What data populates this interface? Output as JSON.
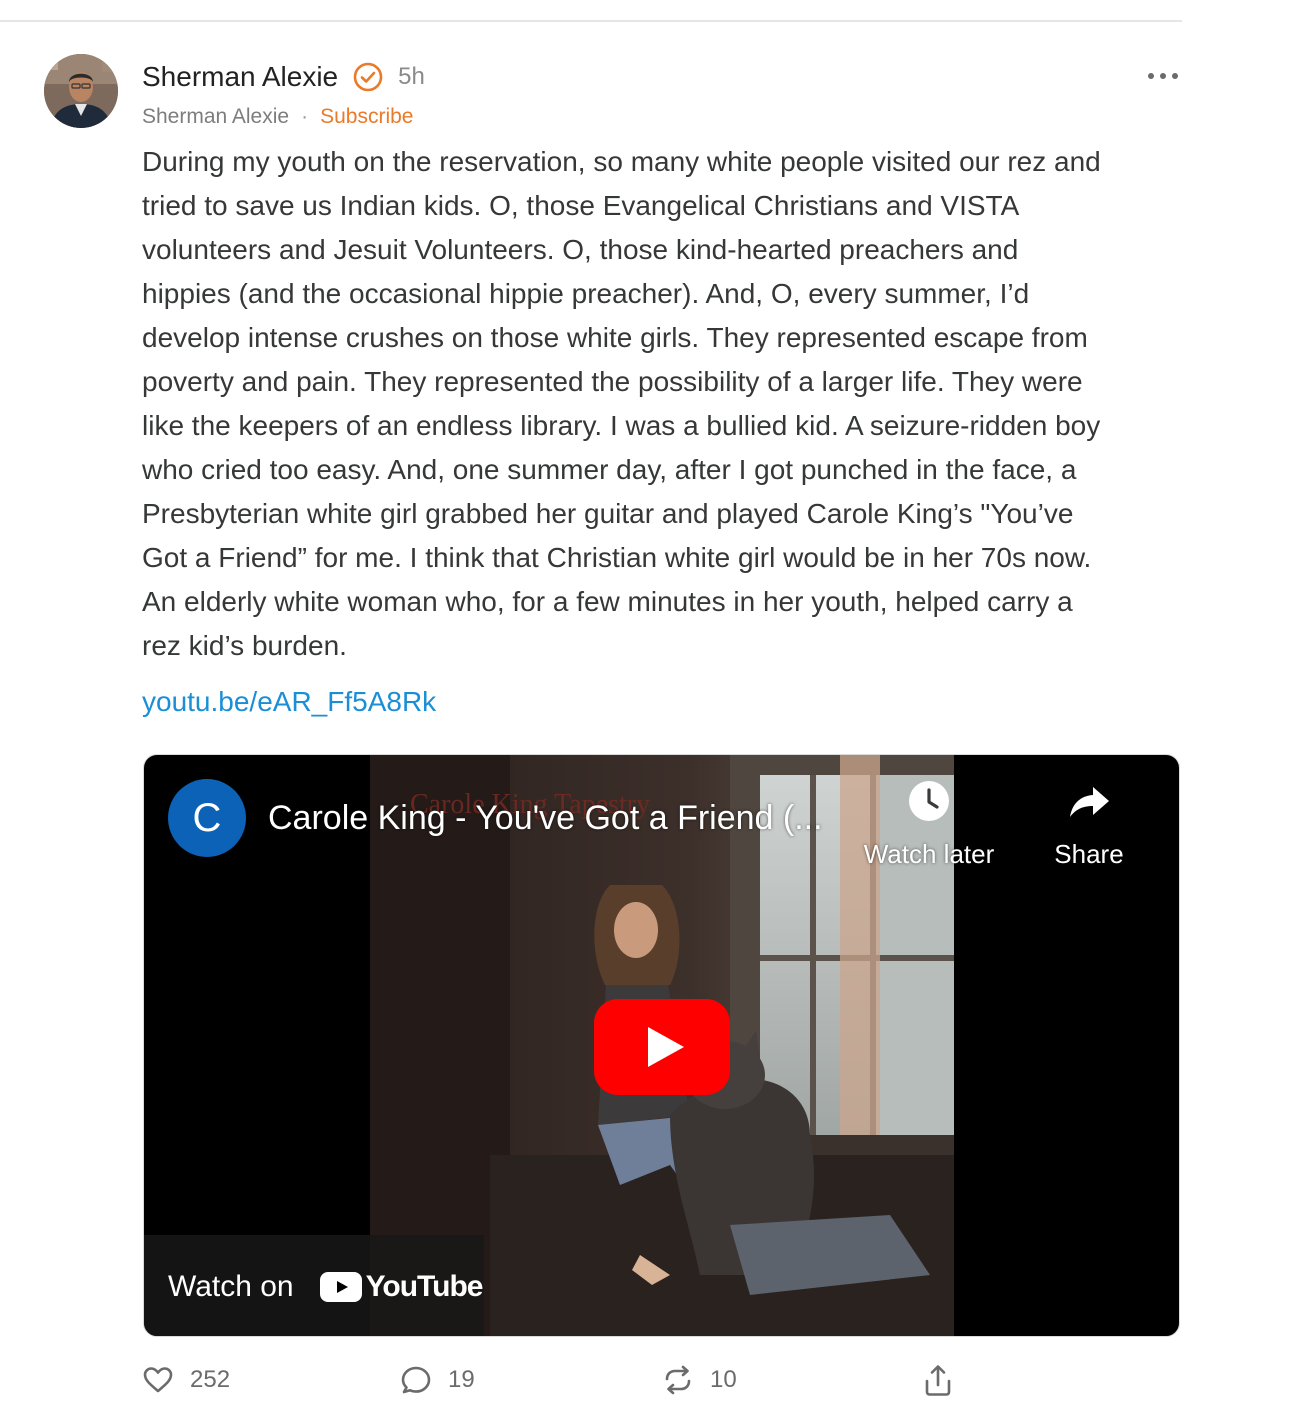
{
  "post": {
    "author_name": "Sherman Alexie",
    "timestamp": "5h",
    "publication": "Sherman Alexie",
    "separator": "·",
    "subscribe_label": "Subscribe",
    "body": "During my youth on the reservation, so many white people visited our rez and\ntried to save us Indian kids. O, those Evangelical Christians and VISTA\nvolunteers and Jesuit Volunteers. O, those kind-hearted preachers and\nhippies (and the occasional hippie preacher). And, O, every summer, I’d\ndevelop intense crushes on those white girls. They represented escape from\npoverty and pain. They represented the possibility of a larger life. They were\nlike the keepers of an endless library.  I was a bullied kid. A seizure-ridden boy\nwho cried too easy. And, one summer day, after I got punched in the face, a\nPresbyterian white girl grabbed her guitar and played Carole King’s \"You’ve\nGot a Friend” for me. I think that Christian white girl would be in her 70s now.\nAn elderly white woman who, for a few minutes in her youth, helped carry a\nrez kid’s burden.",
    "link_text": "youtu.be/eAR_Ff5A8Rk"
  },
  "video": {
    "channel_initial": "C",
    "title": "Carole King - You've Got a Friend (...",
    "watch_later_label": "Watch later",
    "share_label": "Share",
    "watch_on_label": "Watch on",
    "youtube_label": "YouTube",
    "icons": [
      "clock-icon",
      "share-arrow-icon",
      "play-icon",
      "youtube-logo-icon"
    ]
  },
  "actions": {
    "likes": "252",
    "comments": "19",
    "restacks": "10",
    "icons": [
      "heart-icon",
      "comment-icon",
      "restack-icon",
      "share-icon"
    ]
  },
  "colors": {
    "accent": "#ea7a28",
    "link": "#1a8fd6",
    "youtube_red": "#ff0000",
    "channel_blue": "#0b62b6"
  }
}
